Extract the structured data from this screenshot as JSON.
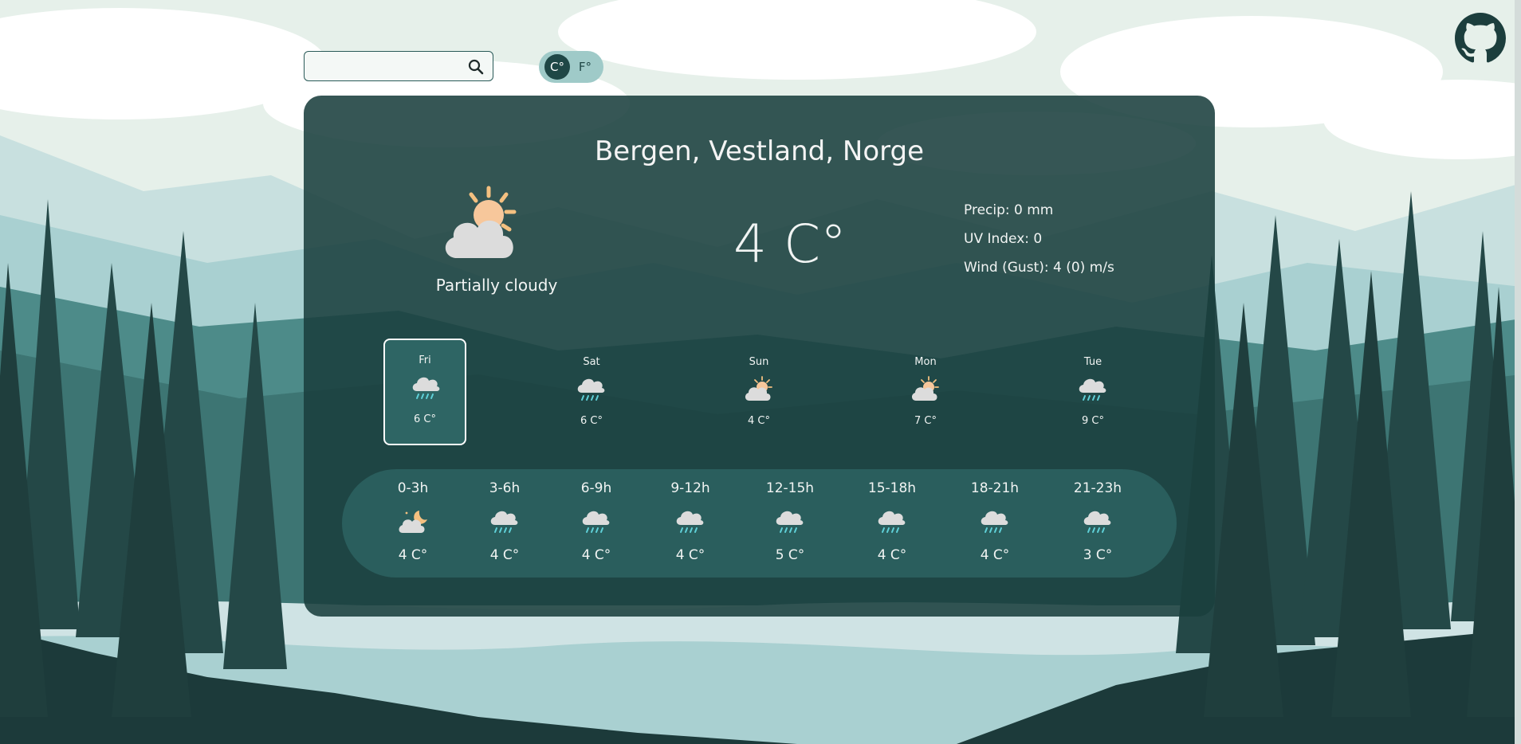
{
  "search": {
    "placeholder": "",
    "value": "",
    "icon": "search-icon"
  },
  "units": {
    "celsius_label": "C°",
    "fahrenheit_label": "F°",
    "selected": "celsius"
  },
  "github": {
    "icon": "github-icon"
  },
  "current": {
    "location": "Bergen, Vestland, Norge",
    "condition": "Partially cloudy",
    "icon": "partly-cloudy-icon",
    "temperature": "4 C°",
    "precip": "Precip: 0 mm",
    "uv": "UV Index: 0",
    "wind": "Wind (Gust): 4 (0) m/s"
  },
  "days": [
    {
      "name": "Fri",
      "temp": "6 C°",
      "icon": "rain-icon",
      "selected": true
    },
    {
      "name": "Sat",
      "temp": "6 C°",
      "icon": "rain-icon",
      "selected": false
    },
    {
      "name": "Sun",
      "temp": "4 C°",
      "icon": "partly-cloudy-icon",
      "selected": false
    },
    {
      "name": "Mon",
      "temp": "7 C°",
      "icon": "partly-cloudy-icon",
      "selected": false
    },
    {
      "name": "Tue",
      "temp": "9 C°",
      "icon": "rain-icon",
      "selected": false
    }
  ],
  "hours": [
    {
      "label": "0-3h",
      "temp": "4 C°",
      "icon": "night-cloudy-icon"
    },
    {
      "label": "3-6h",
      "temp": "4 C°",
      "icon": "rain-icon"
    },
    {
      "label": "6-9h",
      "temp": "4 C°",
      "icon": "rain-icon"
    },
    {
      "label": "9-12h",
      "temp": "4 C°",
      "icon": "rain-icon"
    },
    {
      "label": "12-15h",
      "temp": "5 C°",
      "icon": "rain-icon"
    },
    {
      "label": "15-18h",
      "temp": "4 C°",
      "icon": "rain-icon"
    },
    {
      "label": "18-21h",
      "temp": "4 C°",
      "icon": "rain-icon"
    },
    {
      "label": "21-23h",
      "temp": "3 C°",
      "icon": "rain-icon"
    }
  ],
  "colors": {
    "card": "#1a3f3e",
    "accent": "#2e6564",
    "toggle_bg": "#9fcac8",
    "sun": "#f4c080",
    "cloud": "#dcdcdc",
    "rain": "#5fd0d8"
  }
}
